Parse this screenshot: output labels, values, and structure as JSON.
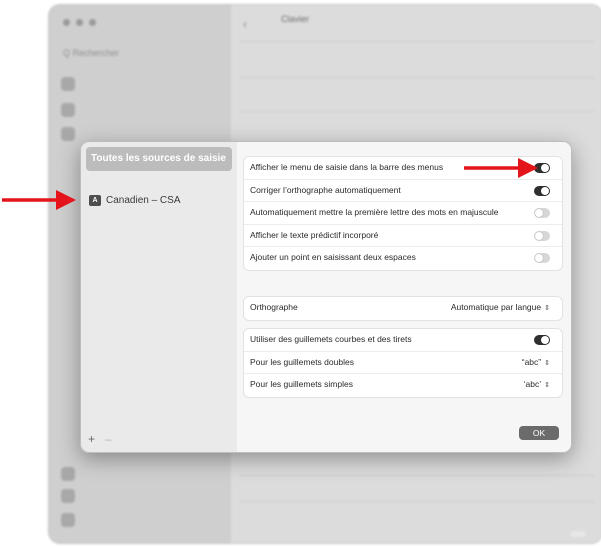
{
  "sheet": {
    "sources_header": "Toutes les sources de saisie",
    "source_item": {
      "badge": "A",
      "label": "Canadien – CSA"
    },
    "add_label": "+",
    "remove_label": "–",
    "settings": [
      {
        "label": "Afficher le menu de saisie dans la barre des menus",
        "toggle": true
      },
      {
        "label": "Corriger l’orthographe automatiquement",
        "toggle": true
      },
      {
        "label": "Automatiquement mettre la première lettre des mots en majuscule",
        "toggle": false
      },
      {
        "label": "Afficher le texte prédictif incorporé",
        "toggle": false
      },
      {
        "label": "Ajouter un point en saisissant deux espaces",
        "toggle": false
      }
    ],
    "spelling": {
      "label": "Orthographe",
      "value": "Automatique par langue"
    },
    "quotes": [
      {
        "label": "Utiliser des guillemets courbes et des tirets",
        "toggle": true
      },
      {
        "label": "Pour les guillemets doubles",
        "value": "“abc”"
      },
      {
        "label": "Pour les guillemets simples",
        "value": "‘abc’"
      }
    ],
    "ok_label": "OK"
  },
  "background": {
    "title": "Clavier",
    "search_placeholder": "Q Rechercher",
    "colors": {
      "accent_arrow": "#e5141b"
    }
  }
}
